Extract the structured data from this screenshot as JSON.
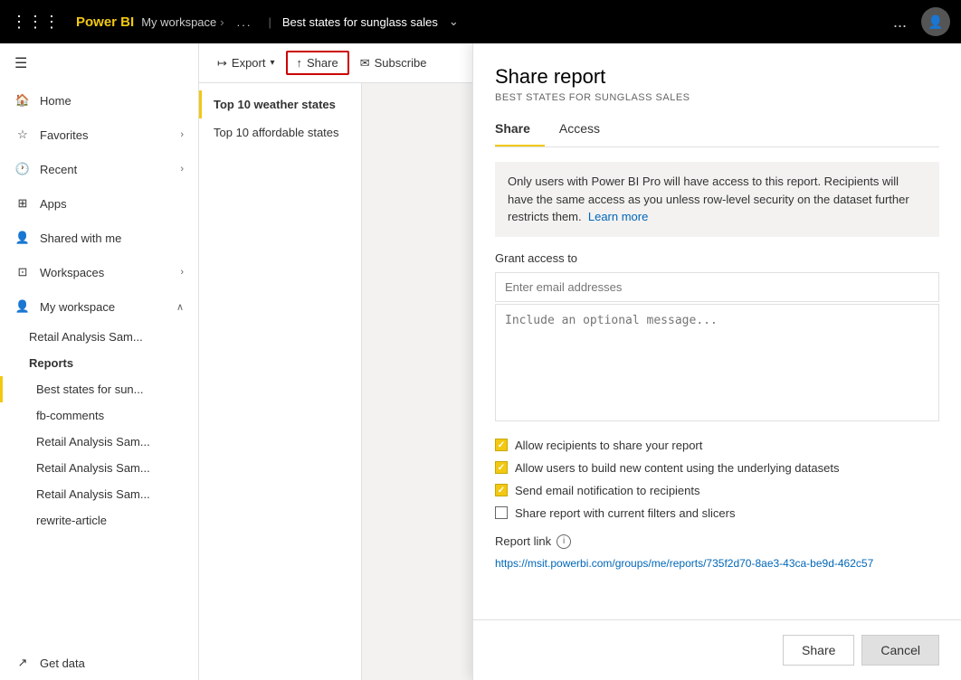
{
  "topbar": {
    "app_name": "Power BI",
    "workspace": "My workspace",
    "report_name": "Best states for sunglass sales",
    "dots_label": "...",
    "more_label": "..."
  },
  "sidebar": {
    "toggle_icon": "☰",
    "items": [
      {
        "id": "home",
        "label": "Home",
        "icon": "🏠"
      },
      {
        "id": "favorites",
        "label": "Favorites",
        "icon": "☆",
        "has_chevron": true
      },
      {
        "id": "recent",
        "label": "Recent",
        "icon": "🕐",
        "has_chevron": true
      },
      {
        "id": "apps",
        "label": "Apps",
        "icon": "⊞"
      },
      {
        "id": "shared",
        "label": "Shared with me",
        "icon": "👤"
      },
      {
        "id": "workspaces",
        "label": "Workspaces",
        "icon": "⊡",
        "has_chevron": true
      },
      {
        "id": "myworkspace",
        "label": "My workspace",
        "icon": "👤",
        "has_chevron": true,
        "expanded": true
      }
    ],
    "workspace_items": [
      {
        "id": "retail-sam",
        "label": "Retail Analysis Sam..."
      },
      {
        "id": "reports",
        "label": "Reports",
        "bold": true
      },
      {
        "id": "best-states",
        "label": "Best states for sun...",
        "active": true
      },
      {
        "id": "fb-comments",
        "label": "fb-comments"
      },
      {
        "id": "retail-sam-2",
        "label": "Retail Analysis Sam..."
      },
      {
        "id": "retail-sam-3",
        "label": "Retail Analysis Sam..."
      },
      {
        "id": "retail-sam-4",
        "label": "Retail Analysis Sam..."
      },
      {
        "id": "rewrite",
        "label": "rewrite-article"
      }
    ],
    "get_data": "Get data"
  },
  "toolbar": {
    "export_label": "Export",
    "share_label": "Share",
    "subscribe_label": "Subscribe"
  },
  "pages": [
    {
      "id": "page1",
      "label": "Top 10 weather states",
      "active": true
    },
    {
      "id": "page2",
      "label": "Top 10 affordable states"
    }
  ],
  "share_panel": {
    "title": "Share report",
    "subtitle": "BEST STATES FOR SUNGLASS SALES",
    "tabs": [
      {
        "id": "share",
        "label": "Share",
        "active": true
      },
      {
        "id": "access",
        "label": "Access"
      }
    ],
    "info_text": "Only users with Power BI Pro will have access to this report. Recipients will have the same access as you unless row-level security on the dataset further restricts them.",
    "learn_more": "Learn more",
    "grant_access_label": "Grant access to",
    "email_placeholder": "Enter email addresses",
    "message_placeholder": "Include an optional message...",
    "checkboxes": [
      {
        "id": "allow-share",
        "label": "Allow recipients to share your report",
        "checked": true
      },
      {
        "id": "allow-build",
        "label": "Allow users to build new content using the underlying datasets",
        "checked": true
      },
      {
        "id": "send-email",
        "label": "Send email notification to recipients",
        "checked": true
      },
      {
        "id": "current-filters",
        "label": "Share report with current filters and slicers",
        "checked": false
      }
    ],
    "report_link_label": "Report link",
    "report_link_url": "https://msit.powerbi.com/groups/me/reports/735f2d70-8ae3-43ca-be9d-462c57",
    "share_button": "Share",
    "cancel_button": "Cancel"
  }
}
